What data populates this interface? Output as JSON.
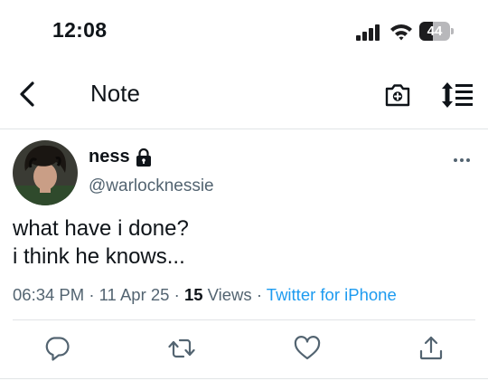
{
  "status_bar": {
    "time": "12:08",
    "battery_level": "44",
    "battery_fraction": 0.44
  },
  "nav": {
    "title": "Note"
  },
  "tweet": {
    "display_name": "ness",
    "username": "@warlocknessie",
    "text_lines": [
      "what have i done?",
      "i think he knows..."
    ],
    "time": "06:34 PM",
    "date": "11 Apr 25",
    "views_count": "15",
    "views_label": "Views",
    "source": "Twitter for iPhone",
    "separator": "·"
  },
  "icons": {
    "back": "chevron-left-icon",
    "camera": "camera-add-icon",
    "sort": "sort-icon",
    "more": "more-dots-icon",
    "lock": "lock-icon",
    "reply": "reply-icon",
    "retweet": "retweet-icon",
    "like": "heart-icon",
    "share": "share-icon"
  },
  "colors": {
    "text": "#0f1419",
    "secondary": "#536471",
    "link": "#1d9bf0",
    "divider": "#e1e4e6"
  }
}
